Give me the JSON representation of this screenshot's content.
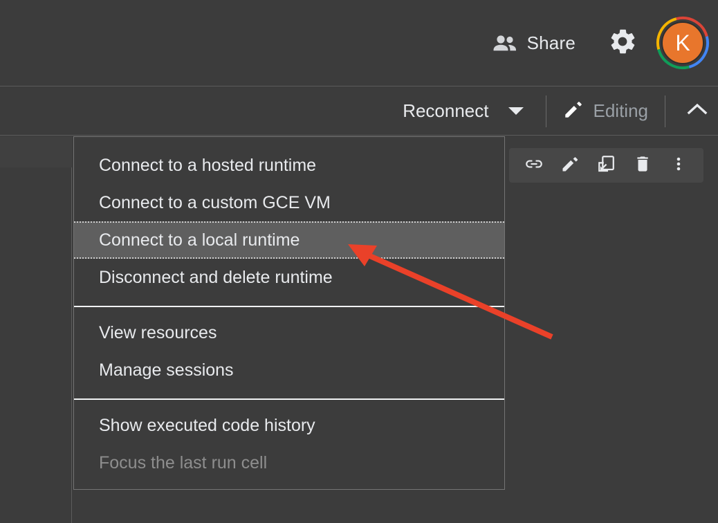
{
  "header": {
    "share_label": "Share",
    "people_icon": "people-icon",
    "gear_icon": "gear-icon",
    "avatar_initial": "K",
    "avatar_color": "#e8762c",
    "ring_colors": {
      "red": "#db4437",
      "blue": "#4285f4",
      "green": "#0f9d58",
      "yellow": "#f4b400"
    }
  },
  "toolbar": {
    "reconnect_label": "Reconnect",
    "caret_icon": "chevron-down-icon",
    "editing_label": "Editing",
    "pencil_icon": "pencil-icon",
    "collapse_icon": "chevron-up-icon"
  },
  "cell_toolbar": {
    "items": [
      {
        "name": "link-icon",
        "title": "Copy link to cell"
      },
      {
        "name": "pencil-icon",
        "title": "Edit"
      },
      {
        "name": "mirror-cell-icon",
        "title": "Mirror cell in tab"
      },
      {
        "name": "trash-icon",
        "title": "Delete cell"
      },
      {
        "name": "more-vert-icon",
        "title": "More cell actions"
      }
    ]
  },
  "menu": {
    "groups": [
      {
        "items": [
          {
            "label": "Connect to a hosted runtime",
            "state": "normal"
          },
          {
            "label": "Connect to a custom GCE VM",
            "state": "normal"
          },
          {
            "label": "Connect to a local runtime",
            "state": "selected"
          },
          {
            "label": "Disconnect and delete runtime",
            "state": "normal"
          }
        ]
      },
      {
        "items": [
          {
            "label": "View resources",
            "state": "normal"
          },
          {
            "label": "Manage sessions",
            "state": "normal"
          }
        ]
      },
      {
        "items": [
          {
            "label": "Show executed code history",
            "state": "normal"
          },
          {
            "label": "Focus the last run cell",
            "state": "disabled"
          }
        ]
      }
    ]
  },
  "annotation": {
    "arrow_color": "#ea4129",
    "points_to": "Connect to a local runtime"
  }
}
